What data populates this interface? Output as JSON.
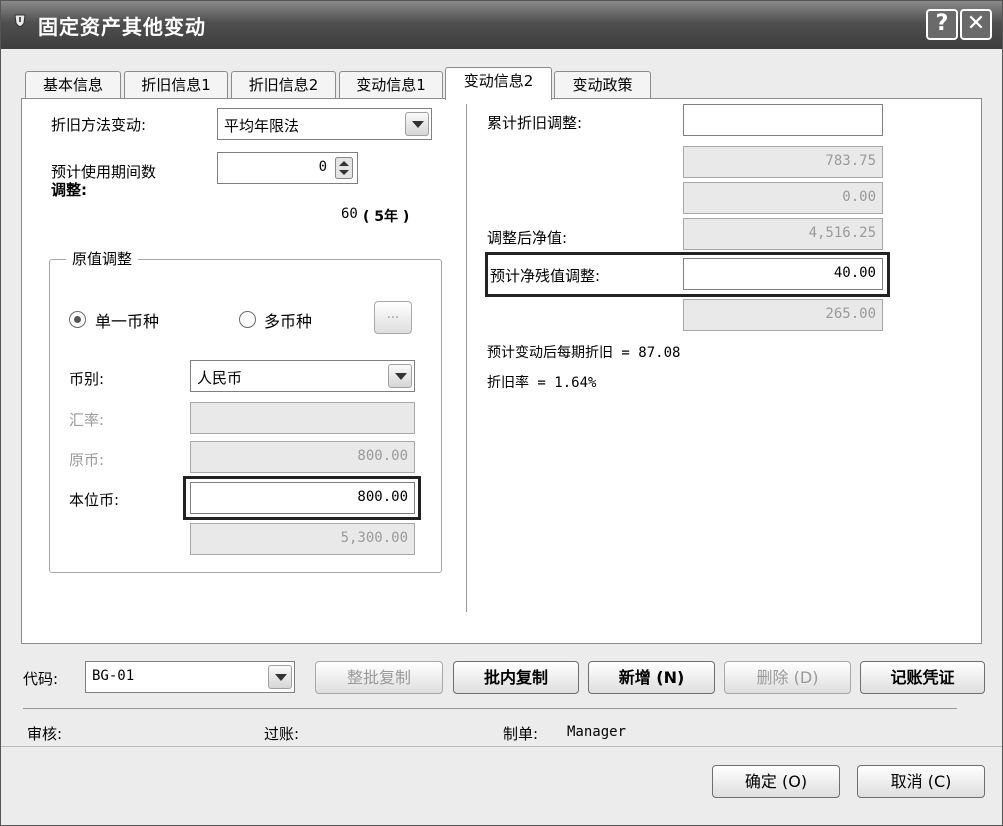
{
  "window": {
    "title": "固定资产其他变动",
    "help_label": "?",
    "close_label": "✕"
  },
  "tabs": [
    {
      "label": "基本信息"
    },
    {
      "label": "折旧信息1"
    },
    {
      "label": "折旧信息2"
    },
    {
      "label": "变动信息1"
    },
    {
      "label": "变动信息2"
    },
    {
      "label": "变动政策"
    }
  ],
  "left": {
    "method_label": "折旧方法变动:",
    "method_value": "平均年限法",
    "period_label_1": "预计使用期间数",
    "period_label_2": "调整:",
    "period_value": "0",
    "period_total": "60",
    "period_years": "( 5年 )",
    "group_title": "原值调整",
    "radio_single": "单一币种",
    "radio_multi": "多币种",
    "more_button": "...",
    "currency_label": "币别:",
    "currency_value": "人民币",
    "rate_label": "汇率:",
    "rate_value": "",
    "original_label": "原币:",
    "original_value": "800.00",
    "local_label": "本位币:",
    "local_value": "800.00",
    "total_value": "5,300.00"
  },
  "right": {
    "accum_label": "累计折旧调整:",
    "accum_value": "",
    "ro_value_1": "783.75",
    "ro_value_2": "0.00",
    "net_label": "调整后净值:",
    "net_value": "4,516.25",
    "residual_label": "预计净残值调整:",
    "residual_value": "40.00",
    "residual_after": "265.00",
    "monthly_dep": "预计变动后每期折旧 = 87.08",
    "dep_rate": "折旧率 = 1.64%"
  },
  "bottom": {
    "code_label": "代码:",
    "code_value": "BG-01",
    "btn_batch_copy": "整批复制",
    "btn_inbatch_copy": "批内复制",
    "btn_add": "新增 (N)",
    "btn_delete": "删除 (D)",
    "btn_voucher": "记账凭证",
    "audit_label": "审核:",
    "post_label": "过账:",
    "maker_label": "制单:",
    "maker_value": "Manager",
    "btn_ok": "确定 (O)",
    "btn_cancel": "取消 (C)"
  }
}
